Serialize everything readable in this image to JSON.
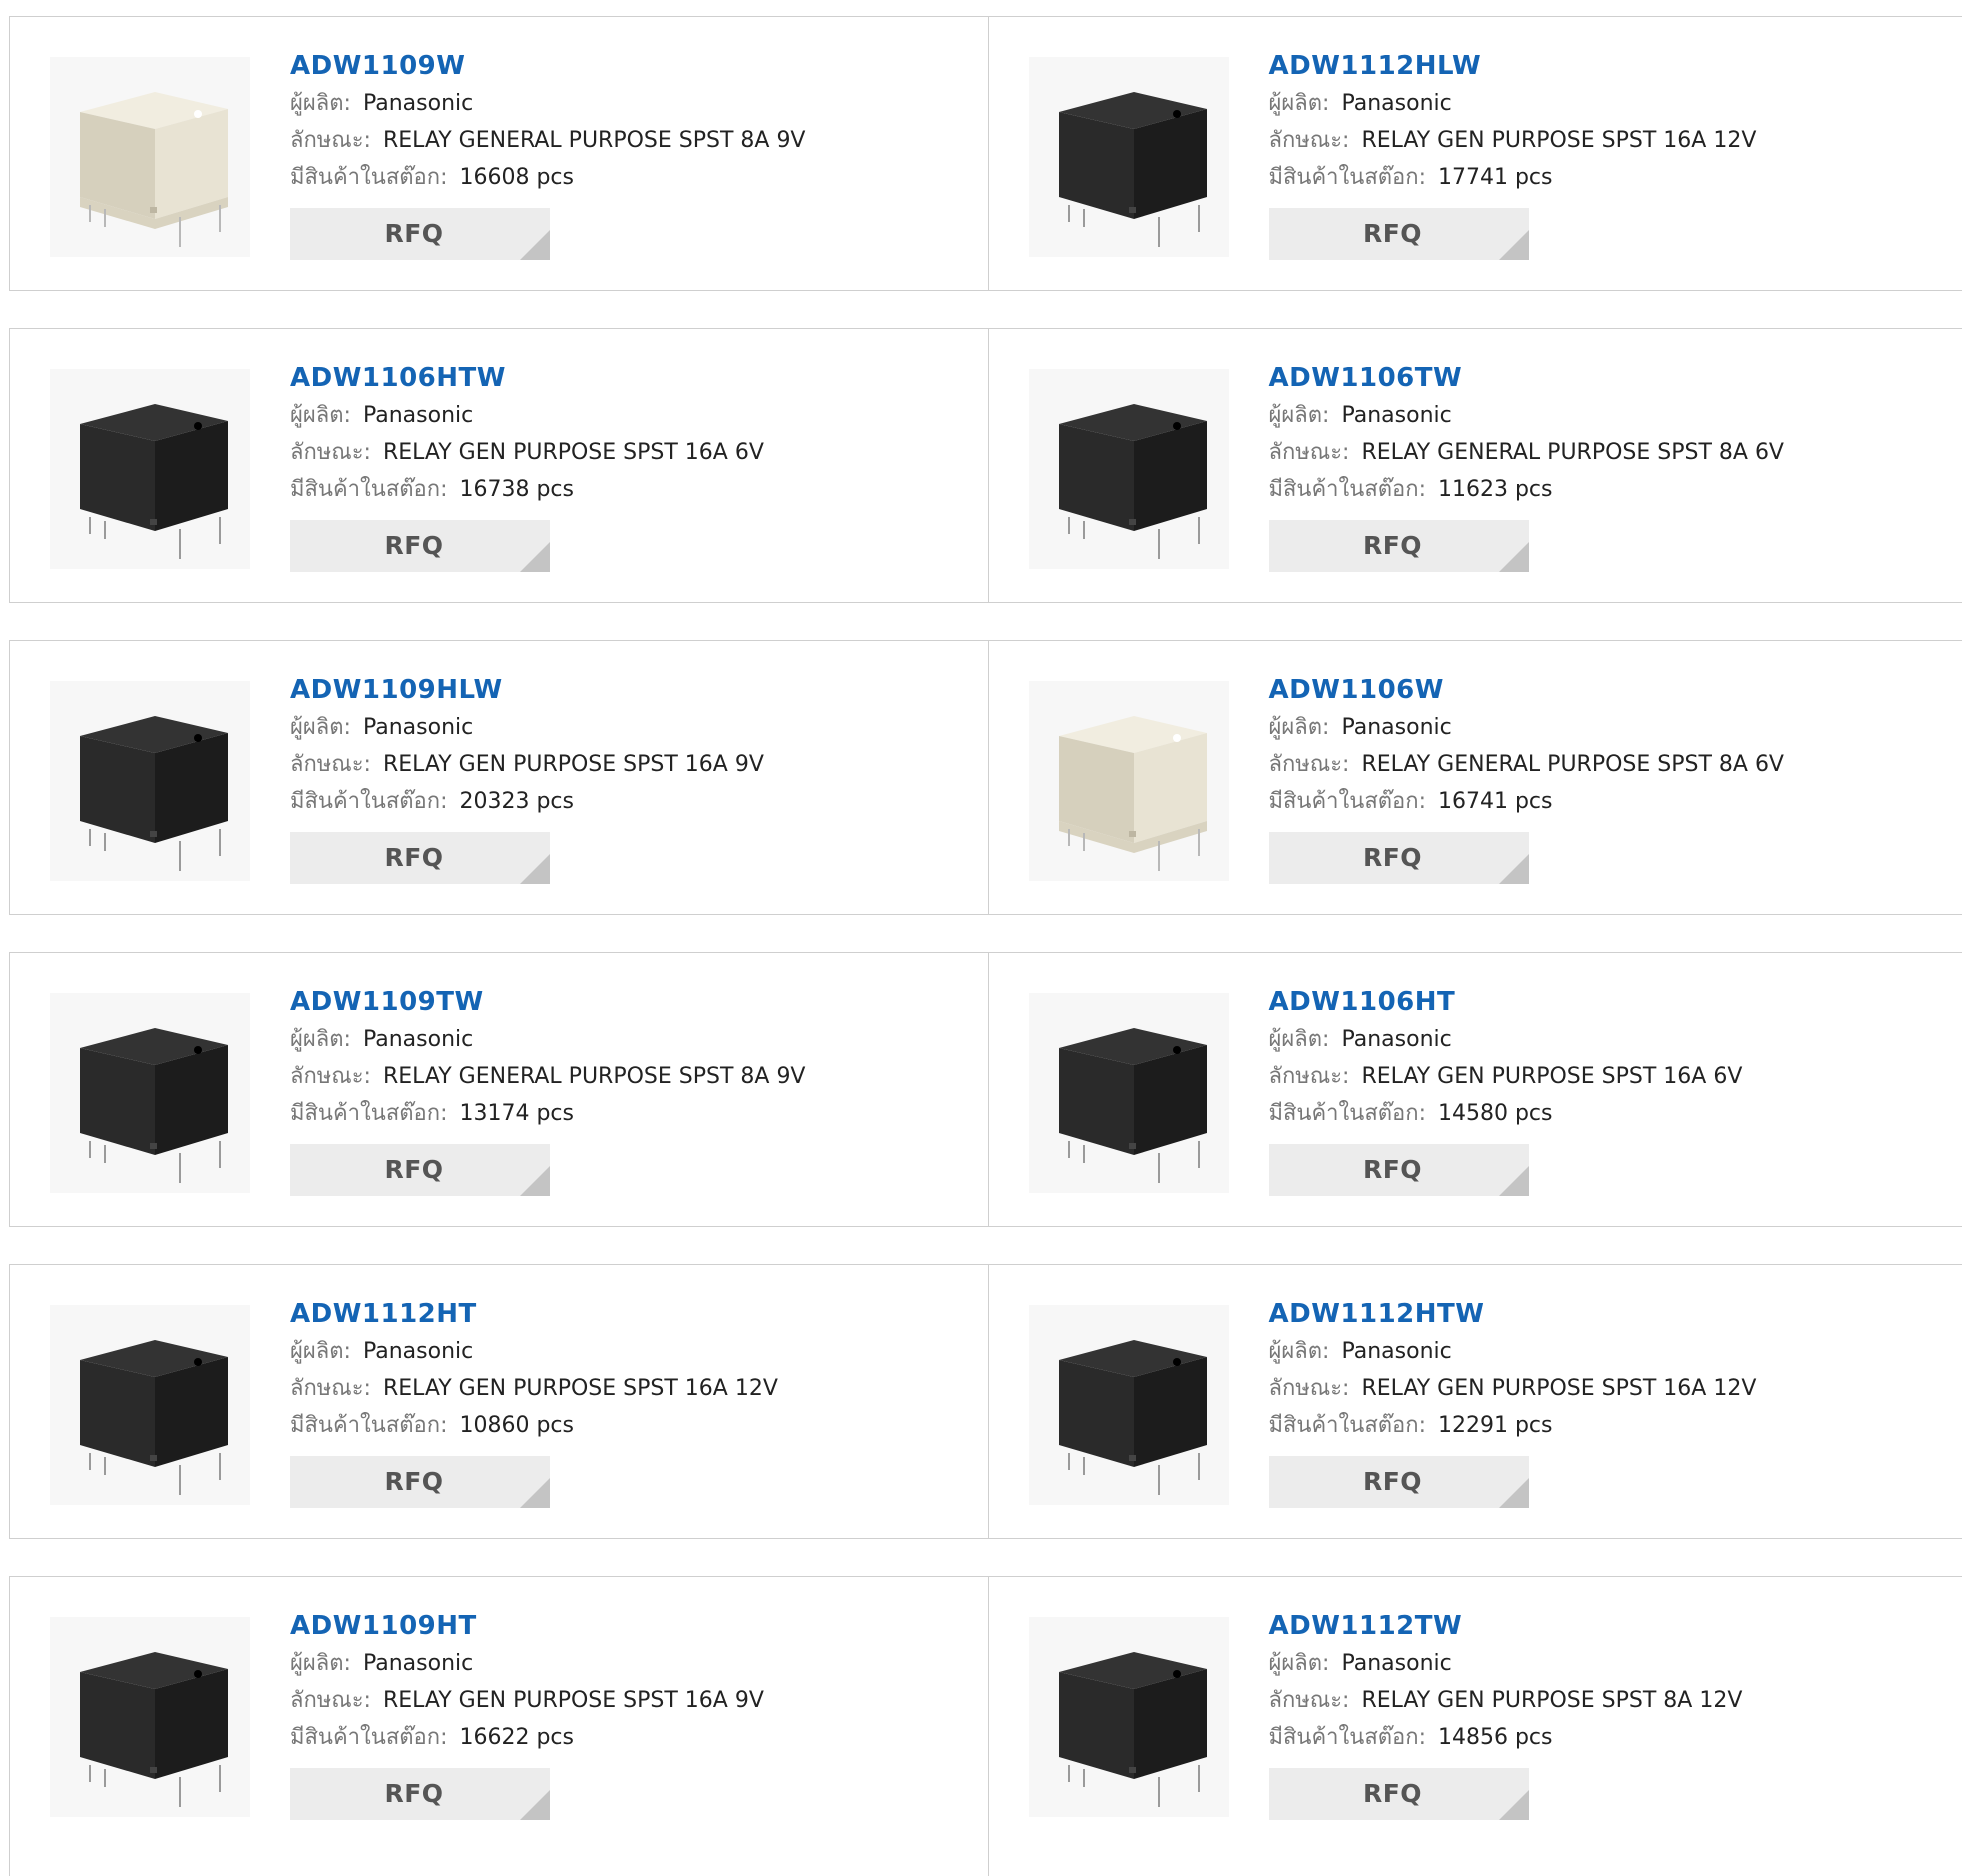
{
  "labels": {
    "manufacturer": "ผู้ผลิต:",
    "description": "ลักษณะ:",
    "stock": "มีสินค้าในสต๊อก:",
    "rfq": "RFQ"
  },
  "colors": {
    "part_link": "#1464b4",
    "rfq_bg": "#ececec",
    "border": "#cfcfcf"
  },
  "products": [
    {
      "part": "ADW1109W",
      "manufacturer": "Panasonic",
      "description": "RELAY GENERAL PURPOSE SPST 8A 9V",
      "stock": "16608 pcs",
      "image": "relay-white"
    },
    {
      "part": "ADW1112HLW",
      "manufacturer": "Panasonic",
      "description": "RELAY GEN PURPOSE SPST 16A 12V",
      "stock": "17741 pcs",
      "image": "relay-black"
    },
    {
      "part": "ADW1106HTW",
      "manufacturer": "Panasonic",
      "description": "RELAY GEN PURPOSE SPST 16A 6V",
      "stock": "16738 pcs",
      "image": "relay-black"
    },
    {
      "part": "ADW1106TW",
      "manufacturer": "Panasonic",
      "description": "RELAY GENERAL PURPOSE SPST 8A 6V",
      "stock": "11623 pcs",
      "image": "relay-black"
    },
    {
      "part": "ADW1109HLW",
      "manufacturer": "Panasonic",
      "description": "RELAY GEN PURPOSE SPST 16A 9V",
      "stock": "20323 pcs",
      "image": "relay-black"
    },
    {
      "part": "ADW1106W",
      "manufacturer": "Panasonic",
      "description": "RELAY GENERAL PURPOSE SPST 8A 6V",
      "stock": "16741 pcs",
      "image": "relay-white"
    },
    {
      "part": "ADW1109TW",
      "manufacturer": "Panasonic",
      "description": "RELAY GENERAL PURPOSE SPST 8A 9V",
      "stock": "13174 pcs",
      "image": "relay-black"
    },
    {
      "part": "ADW1106HT",
      "manufacturer": "Panasonic",
      "description": "RELAY GEN PURPOSE SPST 16A 6V",
      "stock": "14580 pcs",
      "image": "relay-black"
    },
    {
      "part": "ADW1112HT",
      "manufacturer": "Panasonic",
      "description": "RELAY GEN PURPOSE SPST 16A 12V",
      "stock": "10860 pcs",
      "image": "relay-black"
    },
    {
      "part": "ADW1112HTW",
      "manufacturer": "Panasonic",
      "description": "RELAY GEN PURPOSE SPST 16A 12V",
      "stock": "12291 pcs",
      "image": "relay-black"
    },
    {
      "part": "ADW1109HT",
      "manufacturer": "Panasonic",
      "description": "RELAY GEN PURPOSE SPST 16A 9V",
      "stock": "16622 pcs",
      "image": "relay-black"
    },
    {
      "part": "ADW1112TW",
      "manufacturer": "Panasonic",
      "description": "RELAY GEN PURPOSE SPST 8A 12V",
      "stock": "14856 pcs",
      "image": "relay-black"
    }
  ]
}
